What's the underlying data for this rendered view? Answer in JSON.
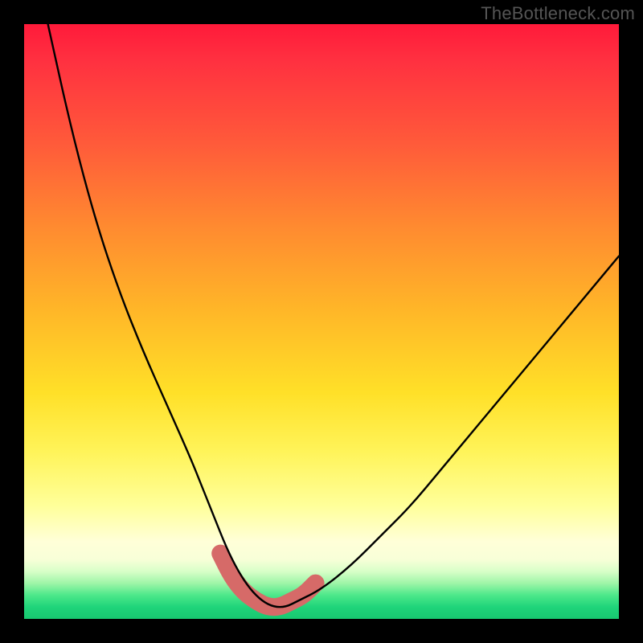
{
  "watermark": "TheBottleneck.com",
  "chart_data": {
    "type": "line",
    "title": "",
    "xlabel": "",
    "ylabel": "",
    "xlim": [
      0,
      100
    ],
    "ylim": [
      0,
      100
    ],
    "series": [
      {
        "name": "bottleneck-curve",
        "x": [
          4,
          8,
          12,
          16,
          20,
          24,
          28,
          30,
          32,
          34,
          36,
          38,
          40,
          42,
          44,
          46,
          50,
          55,
          60,
          65,
          70,
          75,
          80,
          85,
          90,
          95,
          100
        ],
        "values": [
          100,
          82,
          67,
          55,
          45,
          36,
          27,
          22,
          17,
          12,
          8,
          5,
          3,
          2,
          2,
          3,
          5,
          9,
          14,
          19,
          25,
          31,
          37,
          43,
          49,
          55,
          61
        ]
      }
    ],
    "annotation_band": {
      "name": "salmon-highlight",
      "x": [
        33,
        35,
        37,
        39,
        41,
        43,
        45,
        47,
        49
      ],
      "values": [
        11,
        7,
        4.5,
        3,
        2,
        2,
        3,
        4,
        6
      ]
    },
    "gradient_stops": [
      {
        "pos": 0,
        "color": "#ff1a3a"
      },
      {
        "pos": 50,
        "color": "#ffb628"
      },
      {
        "pos": 80,
        "color": "#ffff9a"
      },
      {
        "pos": 95,
        "color": "#4de88a"
      },
      {
        "pos": 100,
        "color": "#18c870"
      }
    ]
  }
}
